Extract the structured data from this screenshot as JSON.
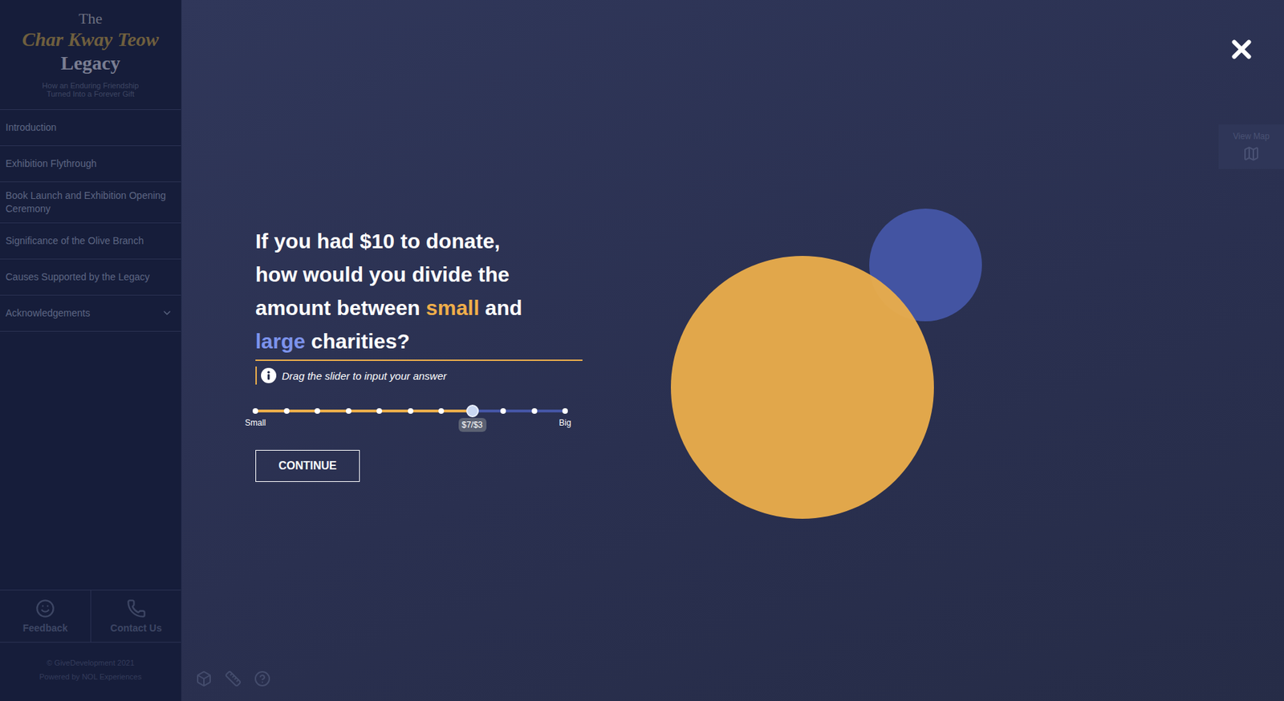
{
  "sidebar": {
    "title_top": "The",
    "title_main": "Char Kway Teow",
    "title_bottom": "Legacy",
    "subtitle": "How an Enduring Friendship Turned Into a Forever Gift",
    "items": [
      {
        "label": "Introduction",
        "expandable": false,
        "expanded": false
      },
      {
        "label": "Exhibition Flythrough",
        "expandable": false,
        "expanded": false
      },
      {
        "label": "Book Launch and Exhibition Opening Ceremony",
        "expandable": false,
        "expanded": false
      },
      {
        "label": "Significance of the Olive Branch",
        "expandable": false,
        "expanded": false
      },
      {
        "label": "Causes Supported by the Legacy",
        "expandable": false,
        "expanded": false
      },
      {
        "label": "Acknowledgements",
        "expandable": true,
        "expanded": false
      }
    ],
    "footer_buttons": [
      {
        "label": "Feedback",
        "kind": "feedback"
      },
      {
        "label": "Contact Us",
        "kind": "contact"
      }
    ],
    "copyright": "© GiveDevelopment 2021",
    "powered_by": "Powered by NOL Experiences"
  },
  "map_button": {
    "label": "View Map"
  },
  "dialog": {
    "question_lines": [
      [
        {
          "text": "If you had $10 to donate,",
          "color": "#ffffff"
        }
      ],
      [
        {
          "text": "how would you divide the",
          "color": "#ffffff"
        }
      ],
      [
        {
          "text": "amount between ",
          "color": "#ffffff"
        },
        {
          "text": "small",
          "color": "#efae4a"
        },
        {
          "text": " and",
          "color": "#ffffff"
        }
      ],
      [
        {
          "text": "large",
          "color": "#7d93ec"
        },
        {
          "text": " charities?",
          "color": "#ffffff"
        }
      ]
    ],
    "hint": "Drag the slider to input your answer",
    "slider": {
      "min_label": "Small",
      "max_label": "Big",
      "reading": "$7/$3",
      "level": 0.7,
      "ticks": 11
    },
    "circles": [
      {
        "side": "small",
        "color": "#ebae4b"
      },
      {
        "side": "large",
        "color": "#4556a6"
      }
    ],
    "button": "CONTINUE"
  }
}
